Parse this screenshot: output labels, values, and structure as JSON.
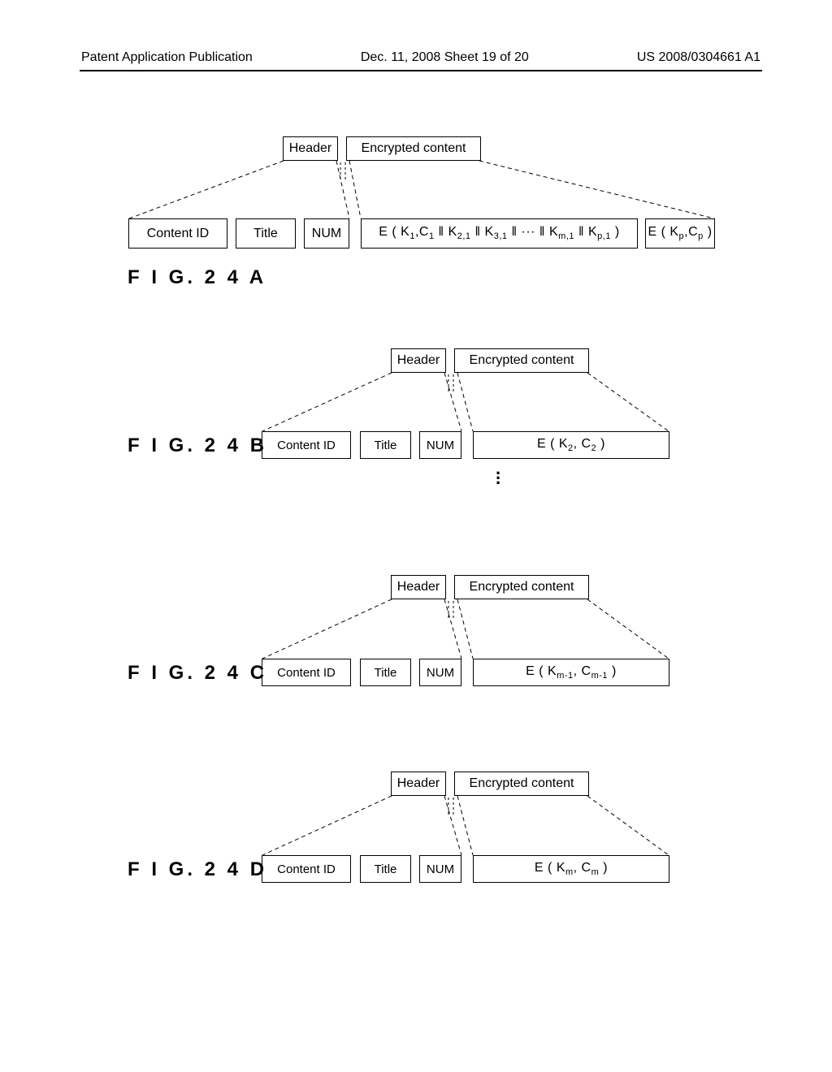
{
  "page_header": {
    "left": "Patent Application Publication",
    "center": "Dec. 11, 2008  Sheet 19 of 20",
    "right": "US 2008/0304661 A1"
  },
  "figures": {
    "a": {
      "label": "F I G. 2 4 A",
      "top_header": "Header",
      "top_encrypted": "Encrypted content",
      "fields": {
        "content_id": "Content ID",
        "title": "Title",
        "num": "NUM"
      },
      "formula_main": "E ( K<sub class='sub'>1</sub>,C<sub class='sub'>1</sub> ‖ K<sub class='sub'>2,1</sub> ‖ K<sub class='sub'>3,1</sub> ‖ ··· ‖ K<sub class='sub'>m,1</sub> ‖ K<sub class='sub'>p,1</sub> )",
      "formula_extra": "E ( K<sub class='sub'>p</sub>,C<sub class='sub'>p</sub> )"
    },
    "b": {
      "label": "F I G. 2 4 B",
      "top_header": "Header",
      "top_encrypted": "Encrypted content",
      "fields": {
        "content_id": "Content ID",
        "title": "Title",
        "num": "NUM"
      },
      "formula": "E ( K<sub class='sub'>2</sub>, C<sub class='sub'>2</sub> )"
    },
    "c": {
      "label": "F I G. 2 4 C",
      "top_header": "Header",
      "top_encrypted": "Encrypted content",
      "fields": {
        "content_id": "Content ID",
        "title": "Title",
        "num": "NUM"
      },
      "formula": "E ( K<sub class='sub'>m-1</sub>, C<sub class='sub'>m-1</sub> )"
    },
    "d": {
      "label": "F I G. 2 4 D",
      "top_header": "Header",
      "top_encrypted": "Encrypted content",
      "fields": {
        "content_id": "Content ID",
        "title": "Title",
        "num": "NUM"
      },
      "formula": "E ( K<sub class='sub'>m</sub>, C<sub class='sub'>m</sub> )"
    }
  },
  "chart_data": {
    "type": "table",
    "note": "Patent figure showing four data-record layouts (FIG.24A–24D). Each record has Header = {Content ID, Title, NUM} and Encrypted content = E(...). FIG.24A additionally carries E(Kp,Cp).",
    "records": [
      {
        "figure": "24A",
        "header_fields": [
          "Content ID",
          "Title",
          "NUM"
        ],
        "encrypted": "E(K1,C1 ‖ K2,1 ‖ K3,1 ‖ … ‖ Km,1 ‖ Kp,1)",
        "extra": "E(Kp,Cp)"
      },
      {
        "figure": "24B",
        "header_fields": [
          "Content ID",
          "Title",
          "NUM"
        ],
        "encrypted": "E(K2, C2)"
      },
      {
        "figure": "24C",
        "header_fields": [
          "Content ID",
          "Title",
          "NUM"
        ],
        "encrypted": "E(Km-1, Cm-1)"
      },
      {
        "figure": "24D",
        "header_fields": [
          "Content ID",
          "Title",
          "NUM"
        ],
        "encrypted": "E(Km, Cm)"
      }
    ]
  }
}
